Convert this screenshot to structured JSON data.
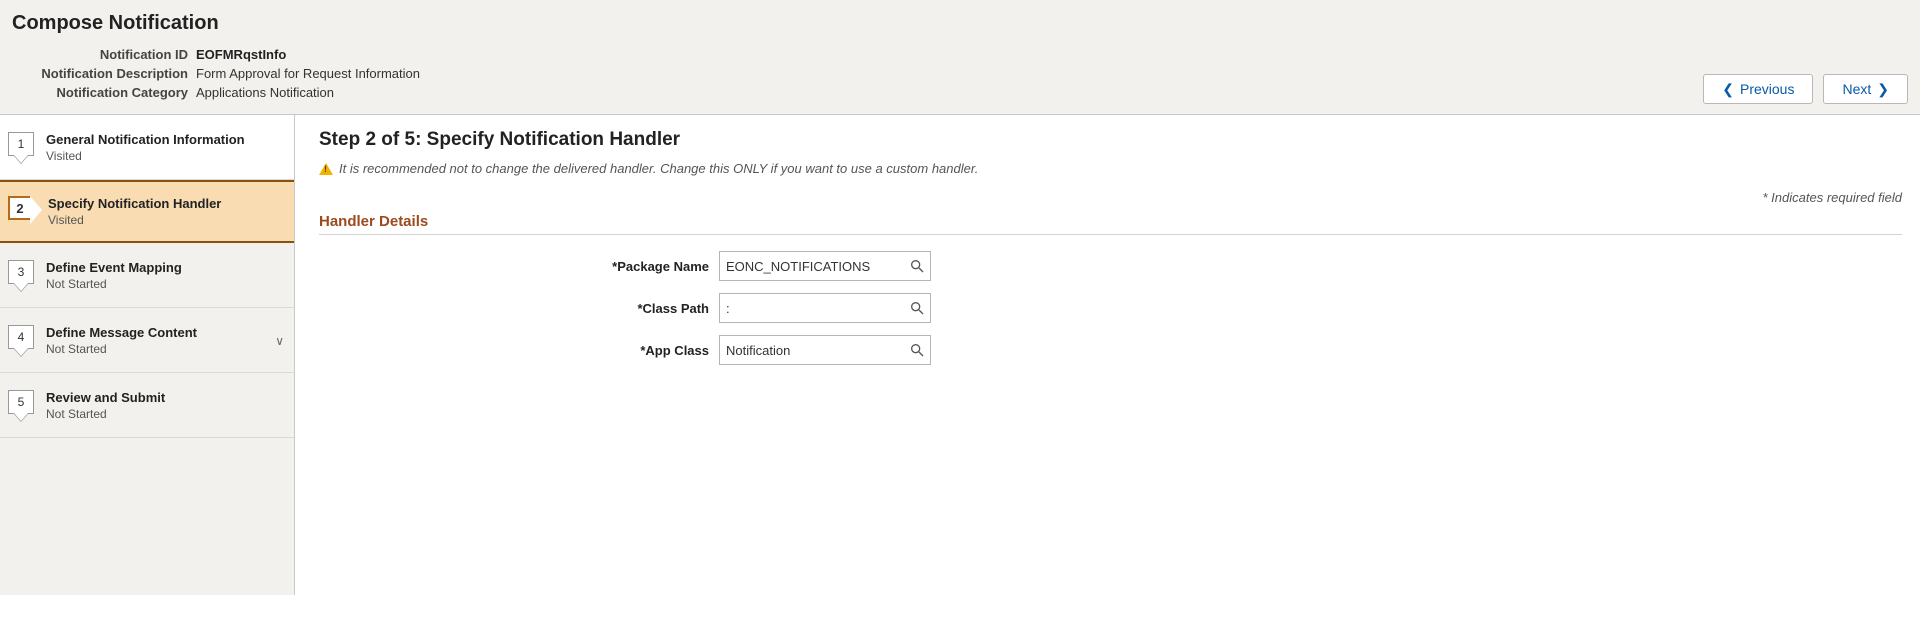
{
  "header": {
    "title": "Compose Notification",
    "fields": {
      "id_label": "Notification ID",
      "id_value": "EOFMRqstInfo",
      "desc_label": "Notification Description",
      "desc_value": "Form Approval for Request Information",
      "cat_label": "Notification Category",
      "cat_value": "Applications Notification"
    },
    "prev_label": "Previous",
    "next_label": "Next"
  },
  "steps": [
    {
      "num": "1",
      "title": "General Notification Information",
      "status": "Visited",
      "selected": false,
      "expandable": false
    },
    {
      "num": "2",
      "title": "Specify Notification Handler",
      "status": "Visited",
      "selected": true,
      "expandable": false
    },
    {
      "num": "3",
      "title": "Define Event Mapping",
      "status": "Not Started",
      "selected": false,
      "expandable": false
    },
    {
      "num": "4",
      "title": "Define Message Content",
      "status": "Not Started",
      "selected": false,
      "expandable": true
    },
    {
      "num": "5",
      "title": "Review and Submit",
      "status": "Not Started",
      "selected": false,
      "expandable": false
    }
  ],
  "main": {
    "heading": "Step 2 of 5: Specify Notification Handler",
    "info": "It is recommended not to change the delivered handler. Change this ONLY if you want to use a custom handler.",
    "required_note": "* Indicates required field",
    "section_title": "Handler Details",
    "fields": {
      "package_label": "*Package Name",
      "package_value": "EONC_NOTIFICATIONS",
      "classpath_label": "*Class Path",
      "classpath_value": ":",
      "appclass_label": "*App Class",
      "appclass_value": "Notification"
    }
  }
}
